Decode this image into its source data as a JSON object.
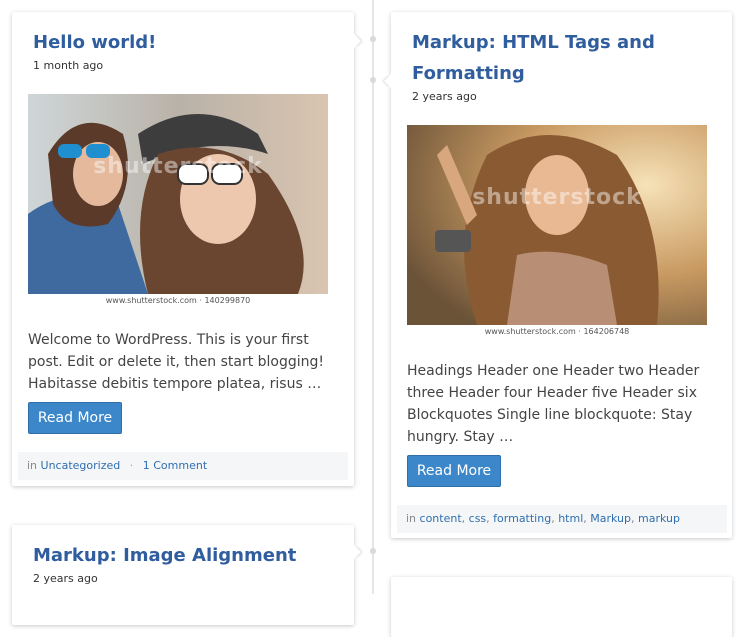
{
  "posts": [
    {
      "title": "Hello world!",
      "date": "1 month ago",
      "image": {
        "watermark": "shutterstock",
        "credit": "www.shutterstock.com · 140299870"
      },
      "excerpt": "Welcome to WordPress. This is your first post. Edit or delete it, then start blogging! Habitasse debitis tempore platea, risus …",
      "button": "Read More",
      "meta": {
        "prefix": "in",
        "category": "Uncategorized",
        "separator": "·",
        "comments": "1 Comment"
      }
    },
    {
      "title": "Markup: HTML Tags and Formatting",
      "date": "2 years ago",
      "image": {
        "watermark": "shutterstock",
        "credit": "www.shutterstock.com · 164206748"
      },
      "excerpt": "Headings Header one Header two Header three Header four Header five Header six Blockquotes Single line blockquote: Stay hungry. Stay …",
      "button": "Read More",
      "meta": {
        "prefix": "in",
        "tags": [
          "content",
          "css",
          "formatting",
          "html",
          "Markup",
          "markup"
        ]
      }
    },
    {
      "title": "Markup: Image Alignment",
      "date": "2 years ago"
    }
  ],
  "colors": {
    "title": "#2f5d9e",
    "button": "#3b87c9",
    "link": "#2f6fb0",
    "meta_bg": "#f5f6f7"
  }
}
